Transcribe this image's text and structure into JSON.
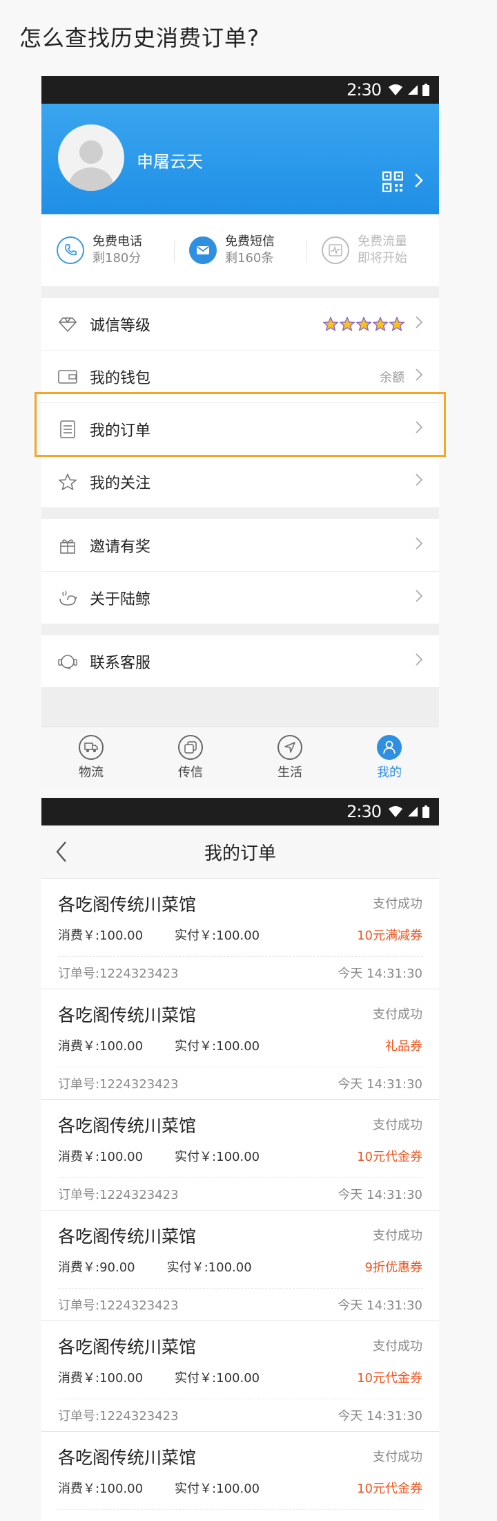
{
  "question": "怎么查找历史消费订单?",
  "statusbar": {
    "time": "2:30"
  },
  "profile": {
    "name": "申屠云天"
  },
  "quotas": [
    {
      "title": "免费电话",
      "sub": "剩180分",
      "icon": "phone-icon"
    },
    {
      "title": "免费短信",
      "sub": "剩160条",
      "icon": "mail-icon"
    },
    {
      "title": "免费流量",
      "sub": "即将开始",
      "icon": "traffic-icon"
    }
  ],
  "menu": {
    "credit": {
      "label": "诚信等级",
      "stars": 5
    },
    "wallet": {
      "label": "我的钱包",
      "value": "余额"
    },
    "orders": {
      "label": "我的订单"
    },
    "follow": {
      "label": "我的关注"
    },
    "invite": {
      "label": "邀请有奖"
    },
    "about": {
      "label": "关于陆鲸"
    },
    "service": {
      "label": "联系客服"
    }
  },
  "nav": [
    {
      "label": "物流",
      "icon": "truck-icon",
      "active": false
    },
    {
      "label": "传信",
      "icon": "message-icon",
      "active": false
    },
    {
      "label": "生活",
      "icon": "navigation-icon",
      "active": false
    },
    {
      "label": "我的",
      "icon": "user-icon",
      "active": true
    }
  ],
  "orders_screen": {
    "title": "我的订单",
    "orders": [
      {
        "shop": "各吃阁传统川菜馆",
        "status": "支付成功",
        "consume": "消费￥:100.00",
        "paid": "实付￥:100.00",
        "coupon": "10元满减券",
        "order_no": "订单号:1224323423",
        "time": "今天 14:31:30"
      },
      {
        "shop": "各吃阁传统川菜馆",
        "status": "支付成功",
        "consume": "消费￥:100.00",
        "paid": "实付￥:100.00",
        "coupon": "礼品券",
        "order_no": "订单号:1224323423",
        "time": "今天 14:31:30"
      },
      {
        "shop": "各吃阁传统川菜馆",
        "status": "支付成功",
        "consume": "消费￥:100.00",
        "paid": "实付￥:100.00",
        "coupon": "10元代金券",
        "order_no": "订单号:1224323423",
        "time": "今天 14:31:30"
      },
      {
        "shop": "各吃阁传统川菜馆",
        "status": "支付成功",
        "consume": "消费￥:90.00",
        "paid": "实付￥:100.00",
        "coupon": "9折优惠券",
        "order_no": "订单号:1224323423",
        "time": "今天 14:31:30"
      },
      {
        "shop": "各吃阁传统川菜馆",
        "status": "支付成功",
        "consume": "消费￥:100.00",
        "paid": "实付￥:100.00",
        "coupon": "10元代金券",
        "order_no": "订单号:1224323423",
        "time": "今天 14:31:30"
      },
      {
        "shop": "各吃阁传统川菜馆",
        "status": "支付成功",
        "consume": "消费￥:100.00",
        "paid": "实付￥:100.00",
        "coupon": "10元代金券",
        "order_no": "",
        "time": ""
      }
    ]
  },
  "colors": {
    "primary": "#2f8fe0",
    "highlight": "#f5a623",
    "coupon": "#f0541e",
    "star": "#f7c21a"
  }
}
